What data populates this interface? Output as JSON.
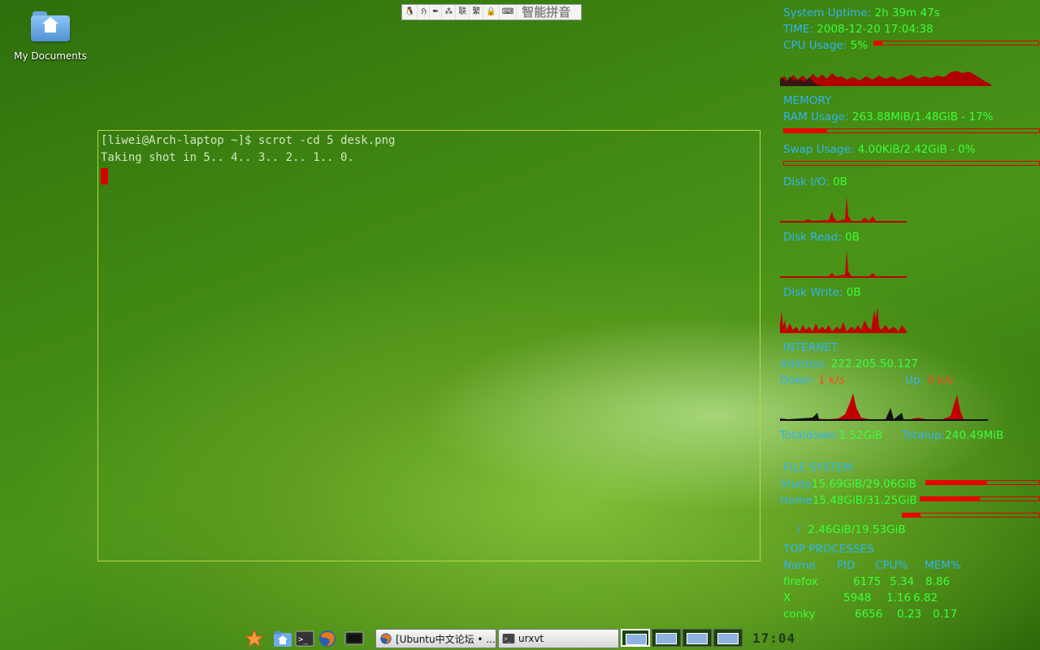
{
  "desktop": {
    "icons": [
      {
        "label": "My Documents",
        "icon": "home-folder-icon"
      }
    ]
  },
  "ime_bar": {
    "name": "智能拼音",
    "items": [
      "linux-penguin-icon",
      "pinyin-mode-icon",
      "quill-icon",
      "punctuation-icon",
      "联",
      "繁",
      "lock-icon",
      "keyboard-icon"
    ]
  },
  "terminal": {
    "lines": [
      "[liwei@Arch-laptop ~]$ scrot -cd 5 desk.png",
      "Taking shot in 5.. 4.. 3.. 2.. 1.. 0."
    ],
    "cursor_color": "#d40000"
  },
  "conky": {
    "uptime_label": "System Uptime:",
    "uptime_value": "2h 39m 47s",
    "time_label": "TIME:",
    "time_value": "2008-12-20 17:04:38",
    "cpu_label": "CPU Usage:",
    "cpu_value": "5%",
    "cpu_fraction": 0.05,
    "memory_header": "MEMORY",
    "ram_label": "RAM Usage:",
    "ram_value": "263.88MiB/1.48GiB - 17%",
    "ram_fraction": 0.17,
    "swap_label": "Swap Usage:",
    "swap_value": "4.00KiB/2.42GiB - 0%",
    "swap_fraction": 0.0,
    "diskio_label": "Disk I/O:",
    "diskio_value": "0B",
    "diskread_label": "Disk Read:",
    "diskread_value": "0B",
    "diskwrite_label": "Disk Write:",
    "diskwrite_value": "0B",
    "internet_header": "INTERNET",
    "address_label": "Address:",
    "address_value": "222.205.50.127",
    "down_label": "Down:",
    "down_value": "1 k/s",
    "up_label": "Up:",
    "up_value": "0 k/s",
    "totaldown_label": "Totaldown:",
    "totaldown_value": "1.52GiB",
    "totalup_label": "Totalup:",
    "totalup_value": "240.49MiB",
    "fs_header": "FILE SYSTEM",
    "filesystems": [
      {
        "name": "Study",
        "value": "15.69GiB/29.06GiB",
        "fraction": 0.54
      },
      {
        "name": "Home",
        "value": "15.48GiB/31.25GiB",
        "fraction": 0.5
      },
      {
        "name": "/  ",
        "value": "2.46GiB/19.53GiB",
        "fraction": 0.13
      }
    ],
    "proc_header": "TOP PROCESSES",
    "proc_columns": [
      "Name",
      "PID",
      "CPU%",
      "MEM%"
    ],
    "processes": [
      {
        "name": "firefox",
        "pid": "6175",
        "cpu": "5.34",
        "mem": "8.86"
      },
      {
        "name": "X",
        "pid": "5948",
        "cpu": "1.16",
        "mem": "6.82"
      },
      {
        "name": "conky",
        "pid": "6656",
        "cpu": "0.23",
        "mem": "0.17"
      }
    ],
    "colors": {
      "label": "#33b3ee",
      "value": "#3bff3b",
      "accent": "#ee0000"
    }
  },
  "taskbar": {
    "launchers": [
      "star-menu-icon",
      "home-folder-icon",
      "terminal-icon",
      "firefox-icon",
      "monitor-icon"
    ],
    "tasks": [
      {
        "label": "[Ubuntu中文论坛 • ...",
        "icon": "firefox-icon"
      },
      {
        "label": "urxvt",
        "icon": "terminal-icon"
      }
    ],
    "workspaces": 4,
    "active_workspace": 1,
    "clock": "17:04"
  }
}
